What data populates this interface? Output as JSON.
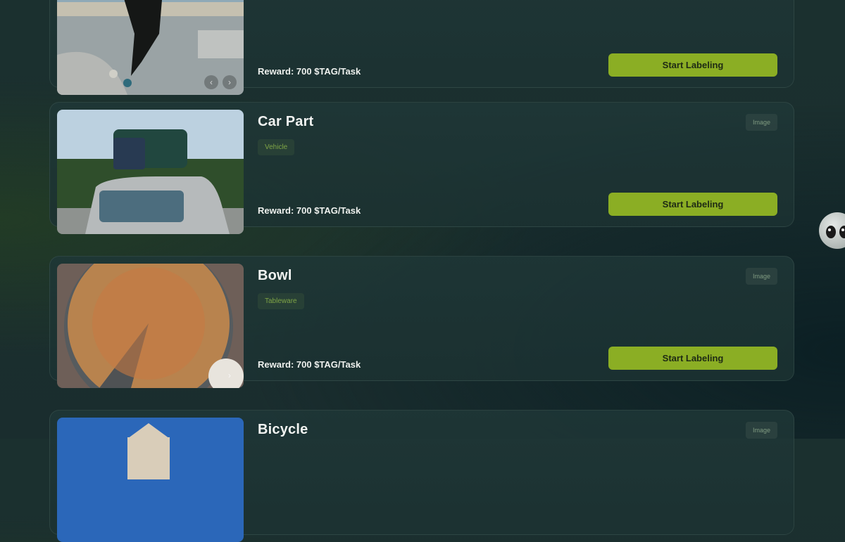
{
  "cards": [
    {
      "title": "",
      "tag": "",
      "type": "",
      "reward": "Reward: 700 $TAG/Task",
      "cta": "Start Labeling",
      "image": "skateboarder-photo"
    },
    {
      "title": "Car Part",
      "tag": "Vehicle",
      "type": "Image",
      "reward": "Reward: 700 $TAG/Task",
      "cta": "Start Labeling",
      "image": "car-roof-cargo-photo"
    },
    {
      "title": "Bowl",
      "tag": "Tableware",
      "type": "Image",
      "reward": "Reward: 700 $TAG/Task",
      "cta": "Start Labeling",
      "image": "fruit-tart-photo"
    },
    {
      "title": "Bicycle",
      "tag": "",
      "type": "Image",
      "reward": "",
      "cta": "",
      "image": "building-sky-photo"
    }
  ],
  "carousel": {
    "prev": "‹",
    "next": "›"
  },
  "colors": {
    "accent": "#8bae24",
    "tag_text": "#7fa446"
  }
}
